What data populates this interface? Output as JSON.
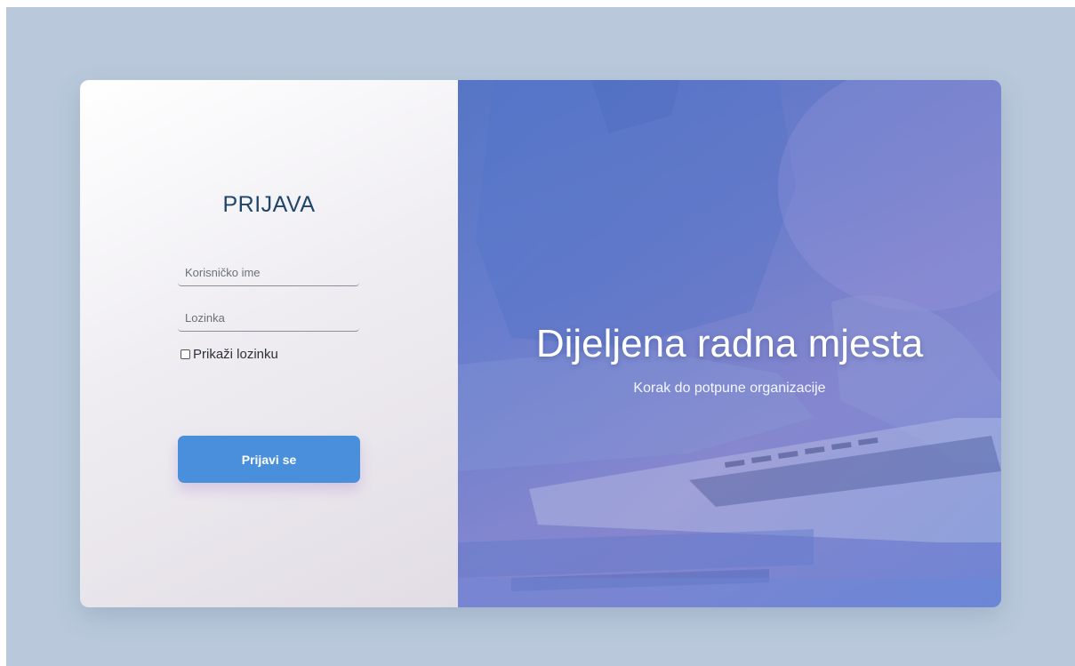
{
  "login": {
    "title": "PRIJAVA",
    "username_placeholder": "Korisničko ime",
    "password_placeholder": "Lozinka",
    "show_password_label": "Prikaži lozinku",
    "show_password_checked": false,
    "submit_label": "Prijavi se"
  },
  "hero": {
    "title": "Dijeljena radna mjesta",
    "subtitle": "Korak do potpune organizacije"
  },
  "colors": {
    "page_background": "#b9c9db",
    "title_color": "#1f4568",
    "button_background": "#4a8fdb",
    "hero_overlay": "#6f84cc"
  }
}
